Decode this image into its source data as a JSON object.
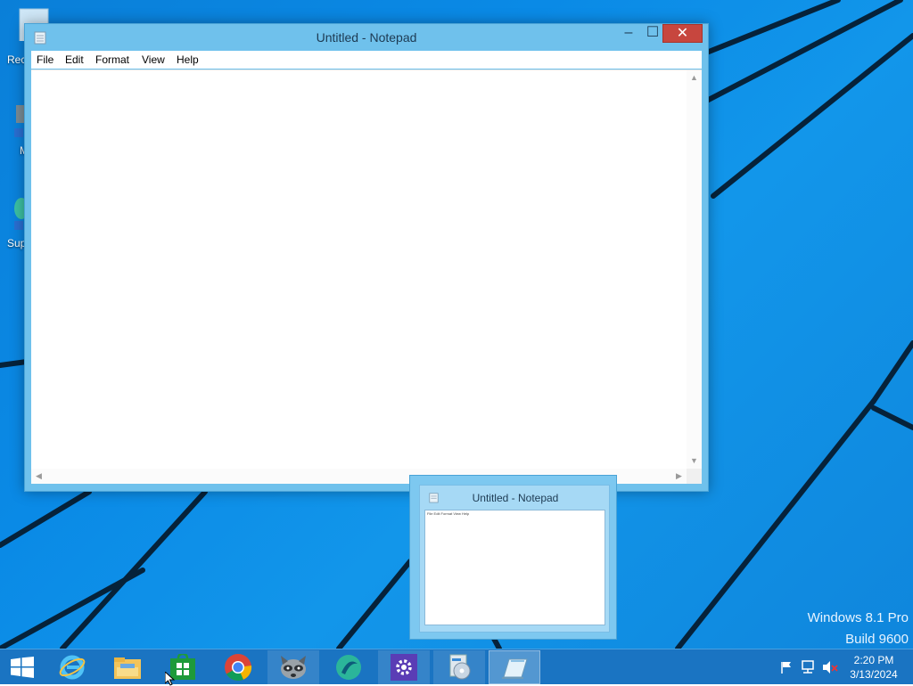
{
  "desktop": {
    "icons": [
      {
        "label": "Rec"
      },
      {
        "label": "M"
      },
      {
        "label": "Sup"
      }
    ]
  },
  "notepad": {
    "title": "Untitled - Notepad",
    "menu": [
      "File",
      "Edit",
      "Format",
      "View",
      "Help"
    ],
    "content": "",
    "controls": {
      "minimize": "‒",
      "maximize": "☐",
      "close": "✕"
    }
  },
  "preview": {
    "title": "Untitled - Notepad",
    "menu_text": "File Edit Format View Help"
  },
  "taskbar": {
    "items": [
      {
        "icon": "start-windows-icon"
      },
      {
        "icon": "internet-explorer-icon"
      },
      {
        "icon": "file-explorer-icon"
      },
      {
        "icon": "windows-store-icon"
      },
      {
        "icon": "chrome-icon"
      },
      {
        "icon": "raccoon-app-icon"
      },
      {
        "icon": "green-app-icon"
      },
      {
        "icon": "settings-gear-icon"
      },
      {
        "icon": "disc-install-icon"
      },
      {
        "icon": "notepad-icon"
      }
    ],
    "clock": {
      "time": "2:20 PM",
      "date": "3/13/2024"
    }
  },
  "watermark": {
    "line1": "Windows 8.1 Pro",
    "line2": "Build 9600"
  },
  "colors": {
    "desktop": "#0a8ae6",
    "taskbar": "#1a74c2",
    "window_frame": "#6fc1ec",
    "close_button": "#c7463e"
  }
}
